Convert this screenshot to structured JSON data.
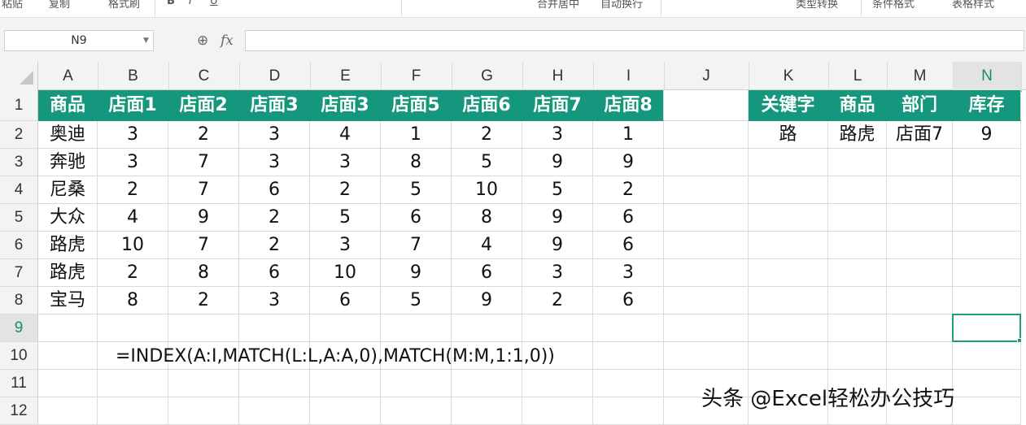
{
  "ribbon": {
    "items": [
      "粘贴",
      "复制",
      "格式刷",
      "B",
      "I",
      "U",
      "合并居中",
      "自动换行",
      "条件格式",
      "类型转换",
      "表格样式"
    ]
  },
  "formula_bar": {
    "name_box": "N9",
    "zoom_icon": "zoom-icon",
    "fx_label": "fx",
    "formula_value": ""
  },
  "columns": [
    "A",
    "B",
    "C",
    "D",
    "E",
    "F",
    "G",
    "H",
    "I",
    "J",
    "K",
    "L",
    "M",
    "N"
  ],
  "rows": [
    "1",
    "2",
    "3",
    "4",
    "5",
    "6",
    "7",
    "8",
    "9",
    "10",
    "11",
    "12"
  ],
  "selected_cell": {
    "column": "N",
    "row": "9"
  },
  "table": {
    "headers": [
      "商品",
      "店面1",
      "店面2",
      "店面3",
      "店面3",
      "店面5",
      "店面6",
      "店面7",
      "店面8"
    ],
    "data": [
      [
        "奥迪",
        "3",
        "2",
        "3",
        "4",
        "1",
        "2",
        "3",
        "1"
      ],
      [
        "奔驰",
        "3",
        "7",
        "3",
        "3",
        "8",
        "5",
        "9",
        "9"
      ],
      [
        "尼桑",
        "2",
        "7",
        "6",
        "2",
        "5",
        "10",
        "5",
        "2"
      ],
      [
        "大众",
        "4",
        "9",
        "2",
        "5",
        "6",
        "8",
        "9",
        "6"
      ],
      [
        "路虎",
        "10",
        "7",
        "2",
        "3",
        "7",
        "4",
        "9",
        "6"
      ],
      [
        "路虎",
        "2",
        "8",
        "6",
        "10",
        "9",
        "6",
        "3",
        "3"
      ],
      [
        "宝马",
        "8",
        "2",
        "3",
        "6",
        "5",
        "9",
        "2",
        "6"
      ]
    ]
  },
  "lookup": {
    "headers": [
      "关键字",
      "商品",
      "部门",
      "库存"
    ],
    "values": [
      "路",
      "路虎",
      "店面7",
      "9"
    ]
  },
  "formula_note": "=INDEX(A:I,MATCH(L:L,A:A,0),MATCH(M:M,1:1,0))",
  "watermark": "头条 @Excel轻松办公技巧",
  "colors": {
    "header_green": "#14977c",
    "selection_green": "#1f9e70"
  }
}
